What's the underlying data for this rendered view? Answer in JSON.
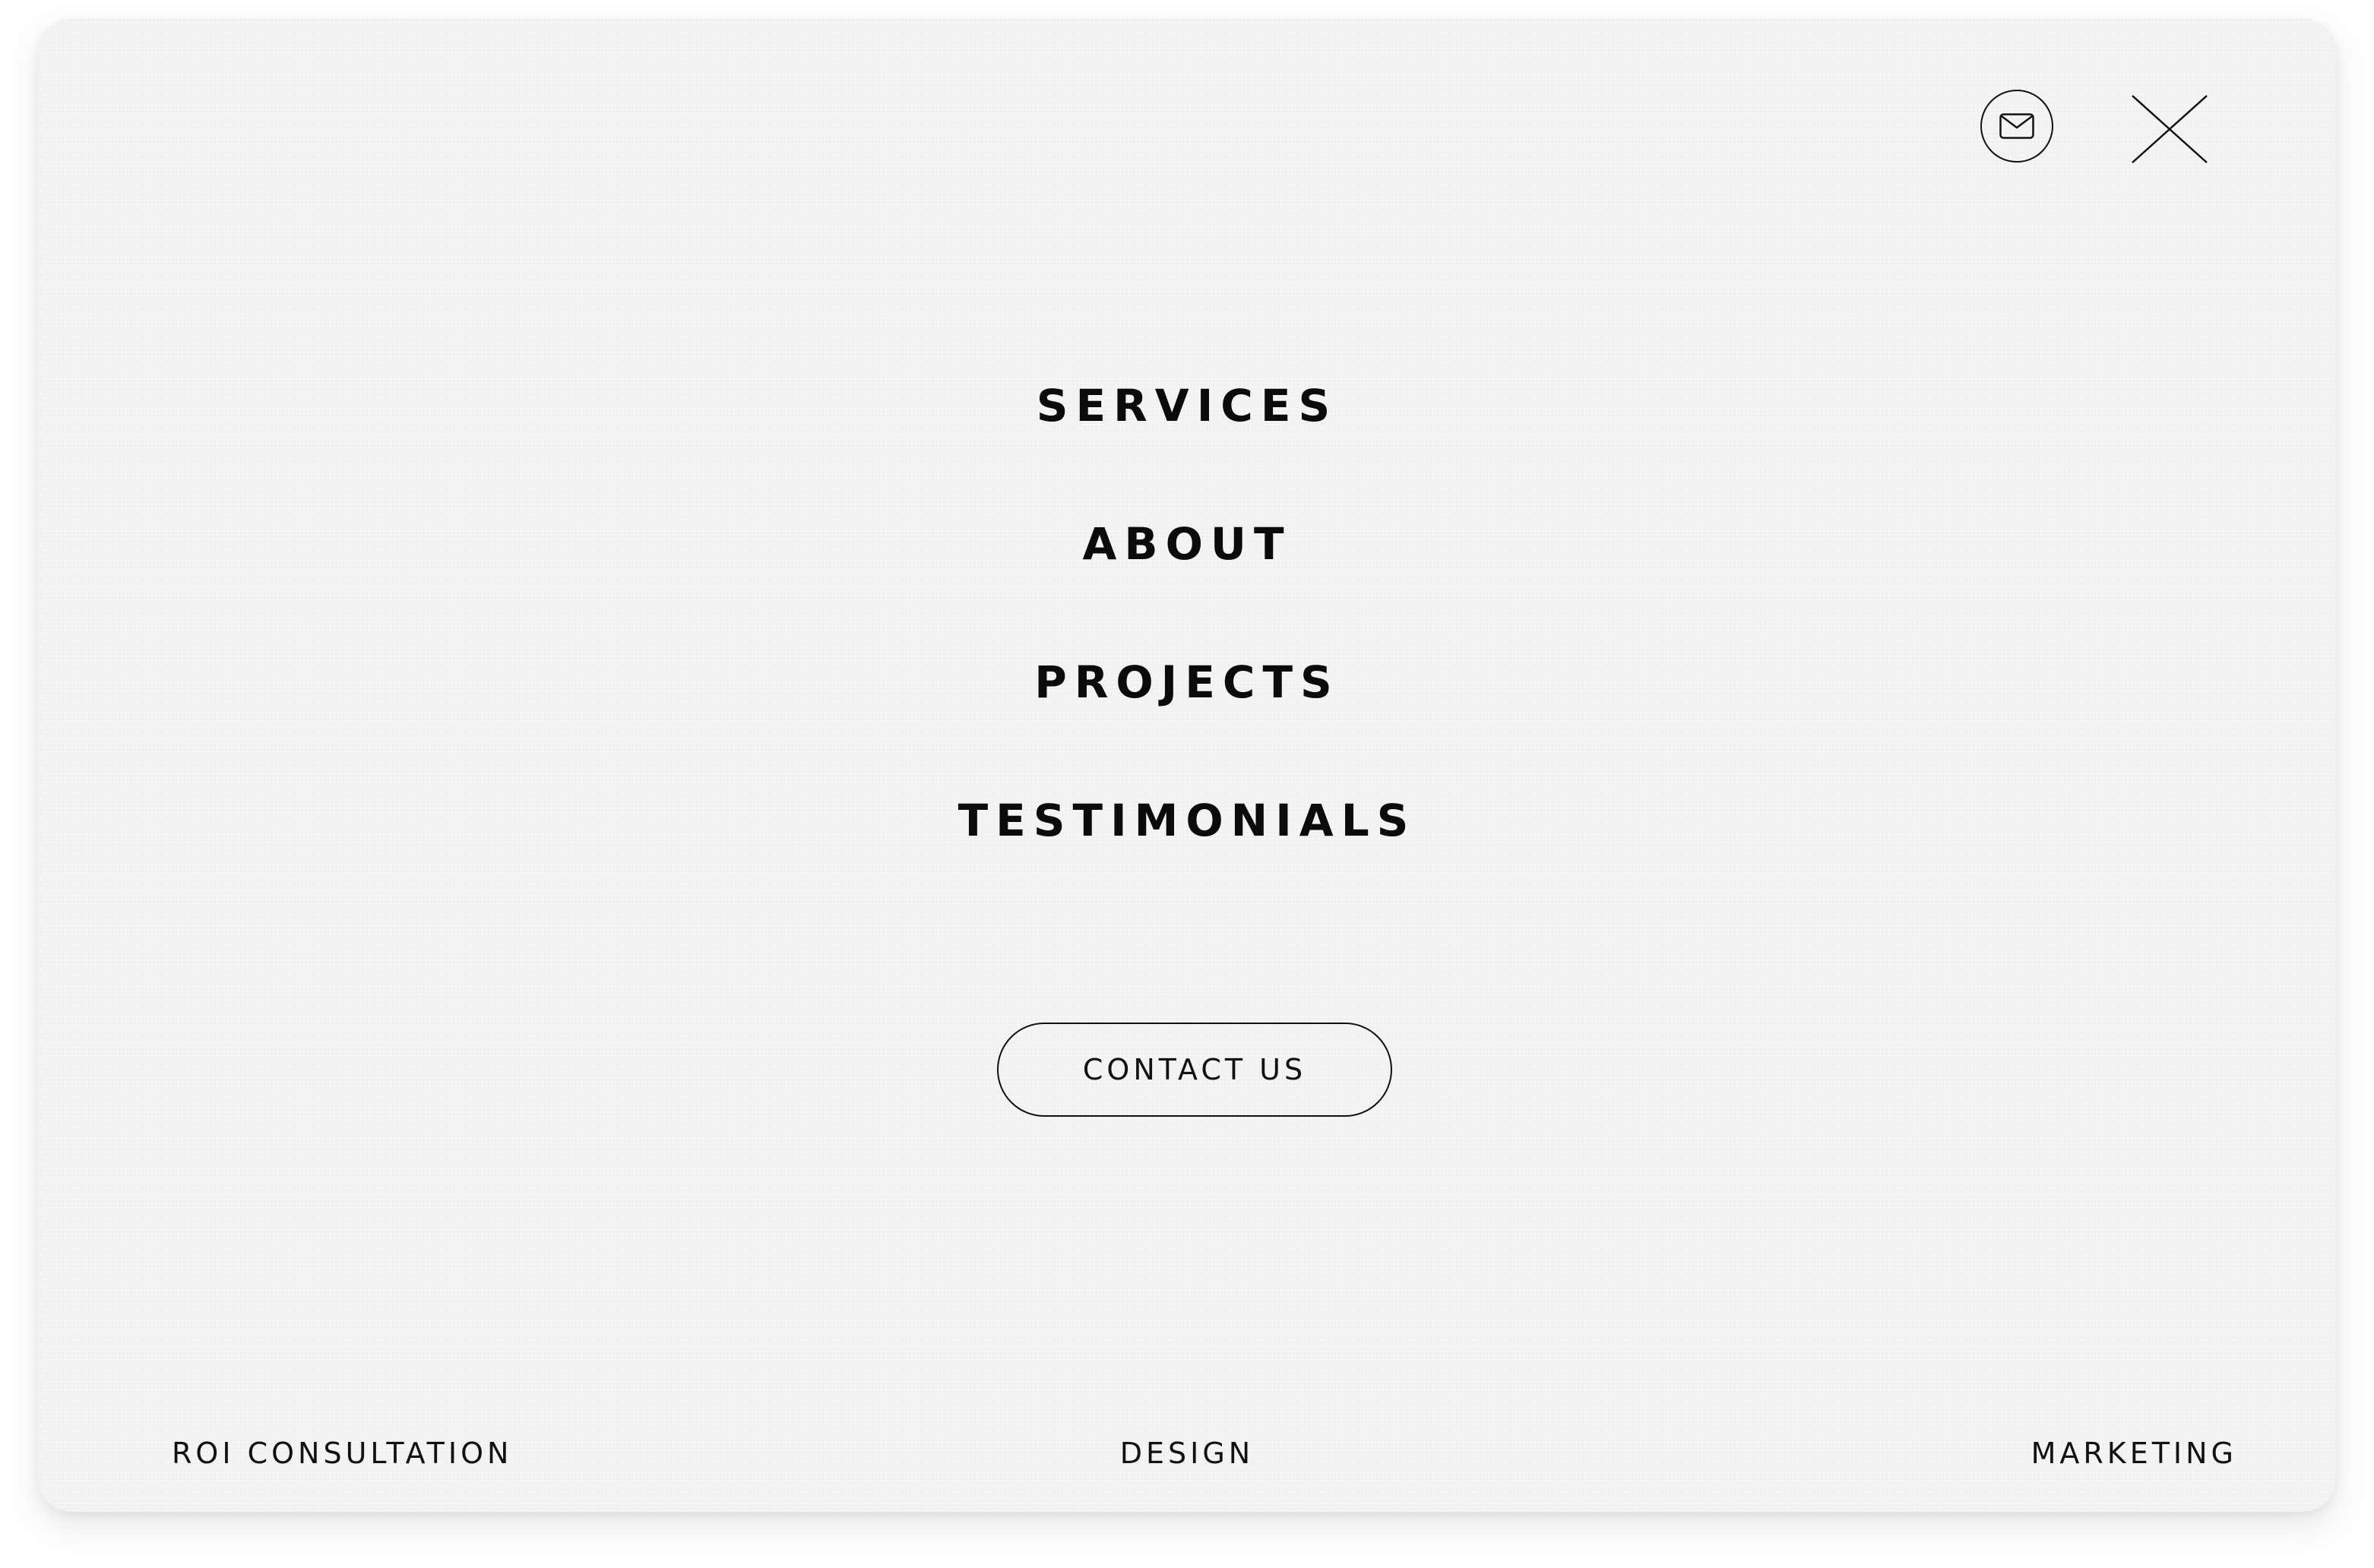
{
  "header": {
    "mail_icon": "envelope-icon",
    "close_icon": "close-x-icon"
  },
  "nav": {
    "items": [
      {
        "label": "SERVICES"
      },
      {
        "label": "ABOUT"
      },
      {
        "label": "PROJECTS"
      },
      {
        "label": "TESTIMONIALS"
      }
    ]
  },
  "cta": {
    "label": "CONTACT US"
  },
  "footer": {
    "left": "ROI CONSULTATION",
    "center": "DESIGN",
    "right": "MARKETING"
  },
  "colors": {
    "background": "#f4f4f4",
    "text": "#0b0b0b"
  }
}
